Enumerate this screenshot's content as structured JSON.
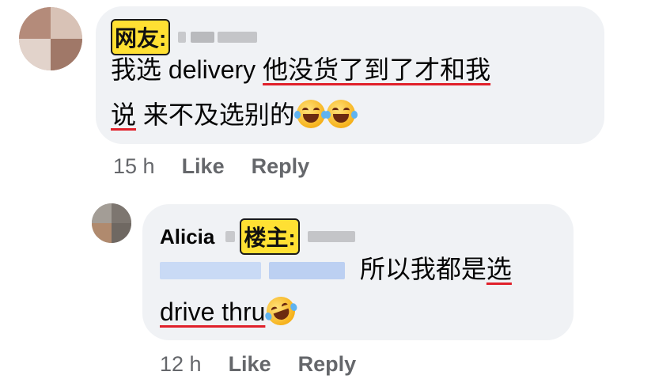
{
  "comments": [
    {
      "author_tag": "网友:",
      "text_line1_plain": "我选 delivery ",
      "text_line1_underlined": "他没货了到了才和我",
      "text_line2_underlined": "说",
      "text_line2_plain": " 来不及选别的",
      "emojis": [
        "laughing-tears-emoji",
        "laughing-tears-emoji"
      ],
      "time": "15 h",
      "like_label": "Like",
      "reply_label": "Reply"
    },
    {
      "author_name": "Alicia",
      "author_tag": "楼主:",
      "text_line1_plain": "所以我都是",
      "text_line1_underlined": "选",
      "text_line2_underlined": "drive thru",
      "emojis": [
        "rolling-laughing-emoji"
      ],
      "time": "12 h",
      "like_label": "Like",
      "reply_label": "Reply"
    }
  ],
  "colors": {
    "bubble_bg": "#f0f2f5",
    "meta_text": "#65676b",
    "underline": "#e0202a",
    "tag_highlight": "#ffe033"
  }
}
